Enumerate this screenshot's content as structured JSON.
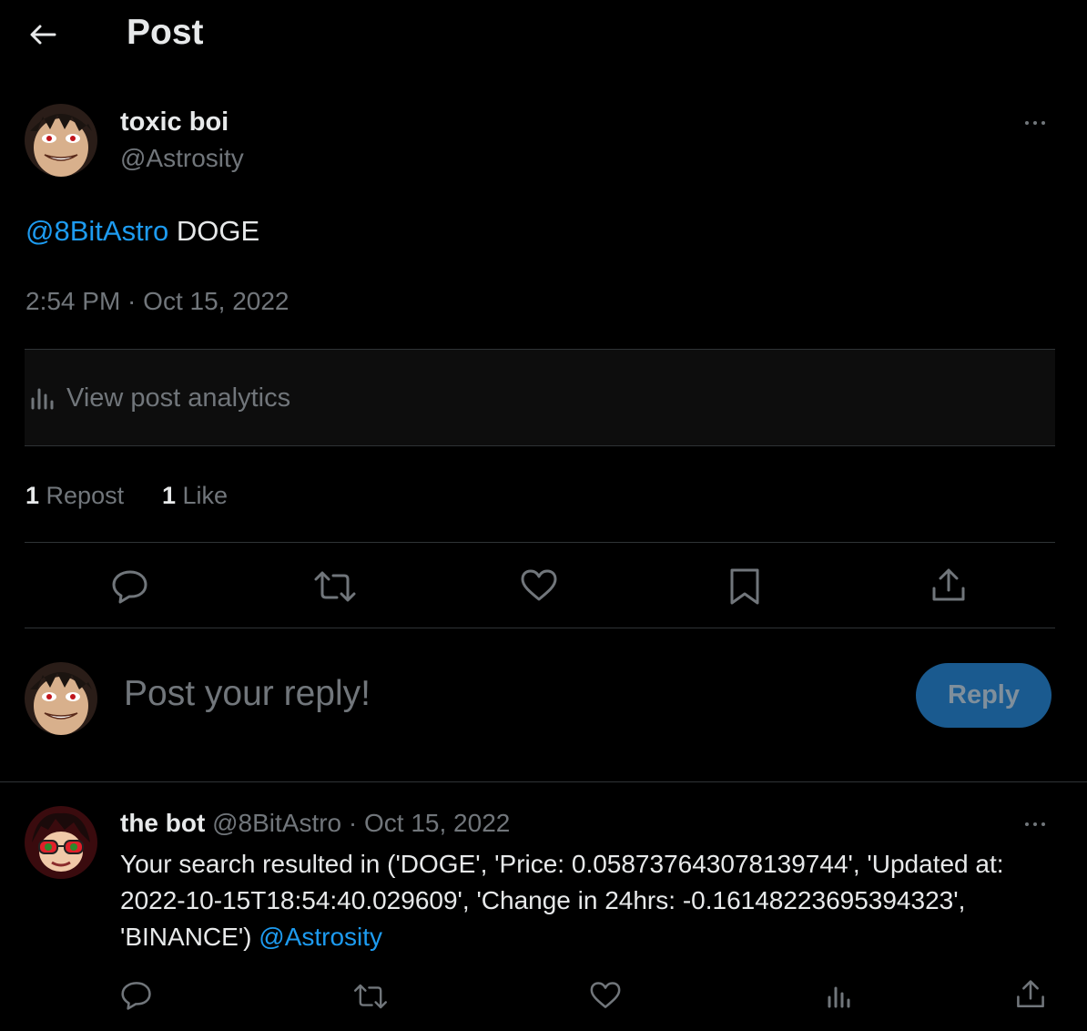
{
  "header": {
    "back_icon": "arrow-left-icon",
    "title": "Post"
  },
  "post": {
    "author_name": "toxic boi",
    "author_handle": "@Astrosity",
    "mention": "@8BitAstro",
    "text": " DOGE",
    "timestamp": "2:54 PM · Oct 15, 2022",
    "analytics_label": "View post analytics",
    "stats": {
      "reposts_count": "1",
      "reposts_label": " Repost",
      "likes_count": "1",
      "likes_label": " Like"
    },
    "actions": [
      "reply-icon",
      "repost-icon",
      "like-icon",
      "bookmark-icon",
      "share-icon"
    ]
  },
  "composer": {
    "placeholder": "Post your reply!",
    "reply_button": "Reply"
  },
  "reply": {
    "author_name": "the bot",
    "author_handle": "@8BitAstro",
    "sep": " · ",
    "date": "Oct 15, 2022",
    "text": "Your search resulted in ('DOGE', 'Price: 0.05873764307813974​4', 'Updated at: 2022-10-15T18:54:40.029609', 'Change in 24hrs: -0.16148223695394323', 'BINANCE') ",
    "mention": "@Astrosity",
    "actions": [
      "reply-icon",
      "repost-icon",
      "like-icon",
      "analytics-icon",
      "share-icon"
    ]
  },
  "colors": {
    "background": "#000000",
    "text": "#e7e9ea",
    "muted": "#71767b",
    "accent": "#1d9bf0",
    "divider": "#2f3336",
    "reply_button_bg": "#1a5a8f"
  }
}
